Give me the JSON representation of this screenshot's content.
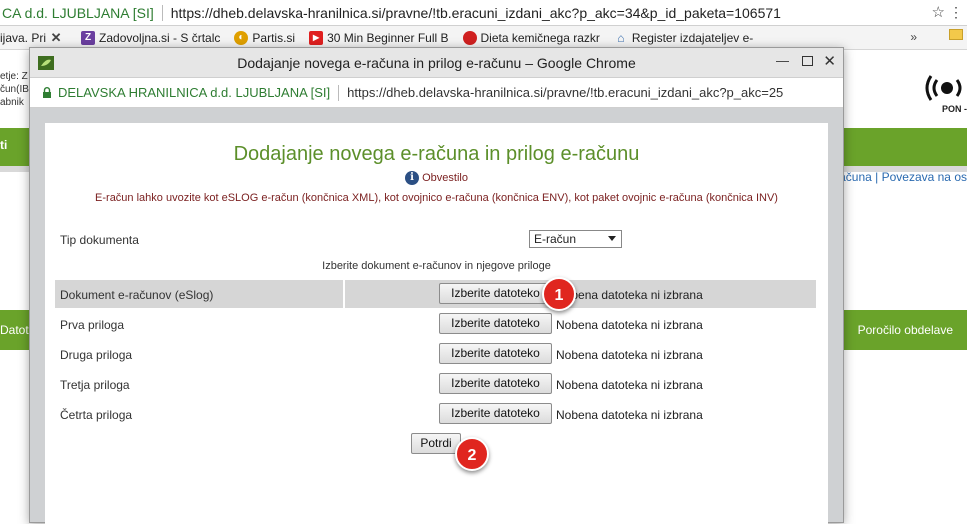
{
  "background_browser": {
    "secure_label": "CA d.d. LJUBLJANA [SI]",
    "url": "https://dheb.delavska-hranilnica.si/pravne/!tb.eracuni_izdani_akc?p_akc=34&p_id_paketa=106571",
    "bookmarks": [
      {
        "label": "ijava. Pri",
        "icon": "x-icon",
        "color": "#444444"
      },
      {
        "label": "Zadovoljna.si - S črtalc",
        "icon": "z-icon",
        "color": "#6b3fa0"
      },
      {
        "label": "Partis.si",
        "icon": "partis-icon",
        "color": "#e0a000"
      },
      {
        "label": "30 Min Beginner Full B",
        "icon": "youtube-icon",
        "color": "#e02020"
      },
      {
        "label": "Dieta kemičnega razkr",
        "icon": "apple-icon",
        "color": "#d02020"
      },
      {
        "label": "Register izdajateljev e-",
        "icon": "register-icon",
        "color": "#3a6fb0"
      }
    ],
    "more_bookmarks": "»",
    "left_text": "etje: Z\nčun(IBA\nabnik",
    "green_left": "ti",
    "green_mid_left": "Datot",
    "green_mid_right": "Poročilo obdelave",
    "links": "računa  |  Povezava na os",
    "logo_text": "PON -"
  },
  "popup": {
    "title": "Dodajanje novega e-računa in prilog e-računu – Google Chrome",
    "secure_label": "DELAVSKA HRANILNICA d.d. LJUBLJANA [SI]",
    "url": "https://dheb.delavska-hranilnica.si/pravne/!tb.eracuni_izdani_akc?p_akc=25"
  },
  "form": {
    "title": "Dodajanje novega e-računa in prilog e-računu",
    "info_label": "Obvestilo",
    "description": "E-račun lahko uvozite kot eSLOG e-račun (končnica XML), kot ovojnico e-računa (končnica ENV), kot paket ovojnic e-računa (končnica INV)",
    "doc_type_label": "Tip dokumenta",
    "doc_type_value": "E-račun",
    "choose_hint": "Izberite dokument e-računov in njegove priloge",
    "file_rows": [
      {
        "label": "Dokument e-računov (eSlog)",
        "button": "Izberite datoteko",
        "status": "Nobena datoteka ni izbrana"
      },
      {
        "label": "Prva priloga",
        "button": "Izberite datoteko",
        "status": "Nobena datoteka ni izbrana"
      },
      {
        "label": "Druga priloga",
        "button": "Izberite datoteko",
        "status": "Nobena datoteka ni izbrana"
      },
      {
        "label": "Tretja priloga",
        "button": "Izberite datoteko",
        "status": "Nobena datoteka ni izbrana"
      },
      {
        "label": "Četrta priloga",
        "button": "Izberite datoteko",
        "status": "Nobena datoteka ni izbrana"
      }
    ],
    "submit_label": "Potrdi"
  },
  "callouts": [
    "1",
    "2"
  ],
  "colors": {
    "accent_green": "#6aa32a",
    "title_green": "#5c8f2a",
    "notice_red": "#7a1f1f",
    "callout_red": "#e0261f"
  }
}
